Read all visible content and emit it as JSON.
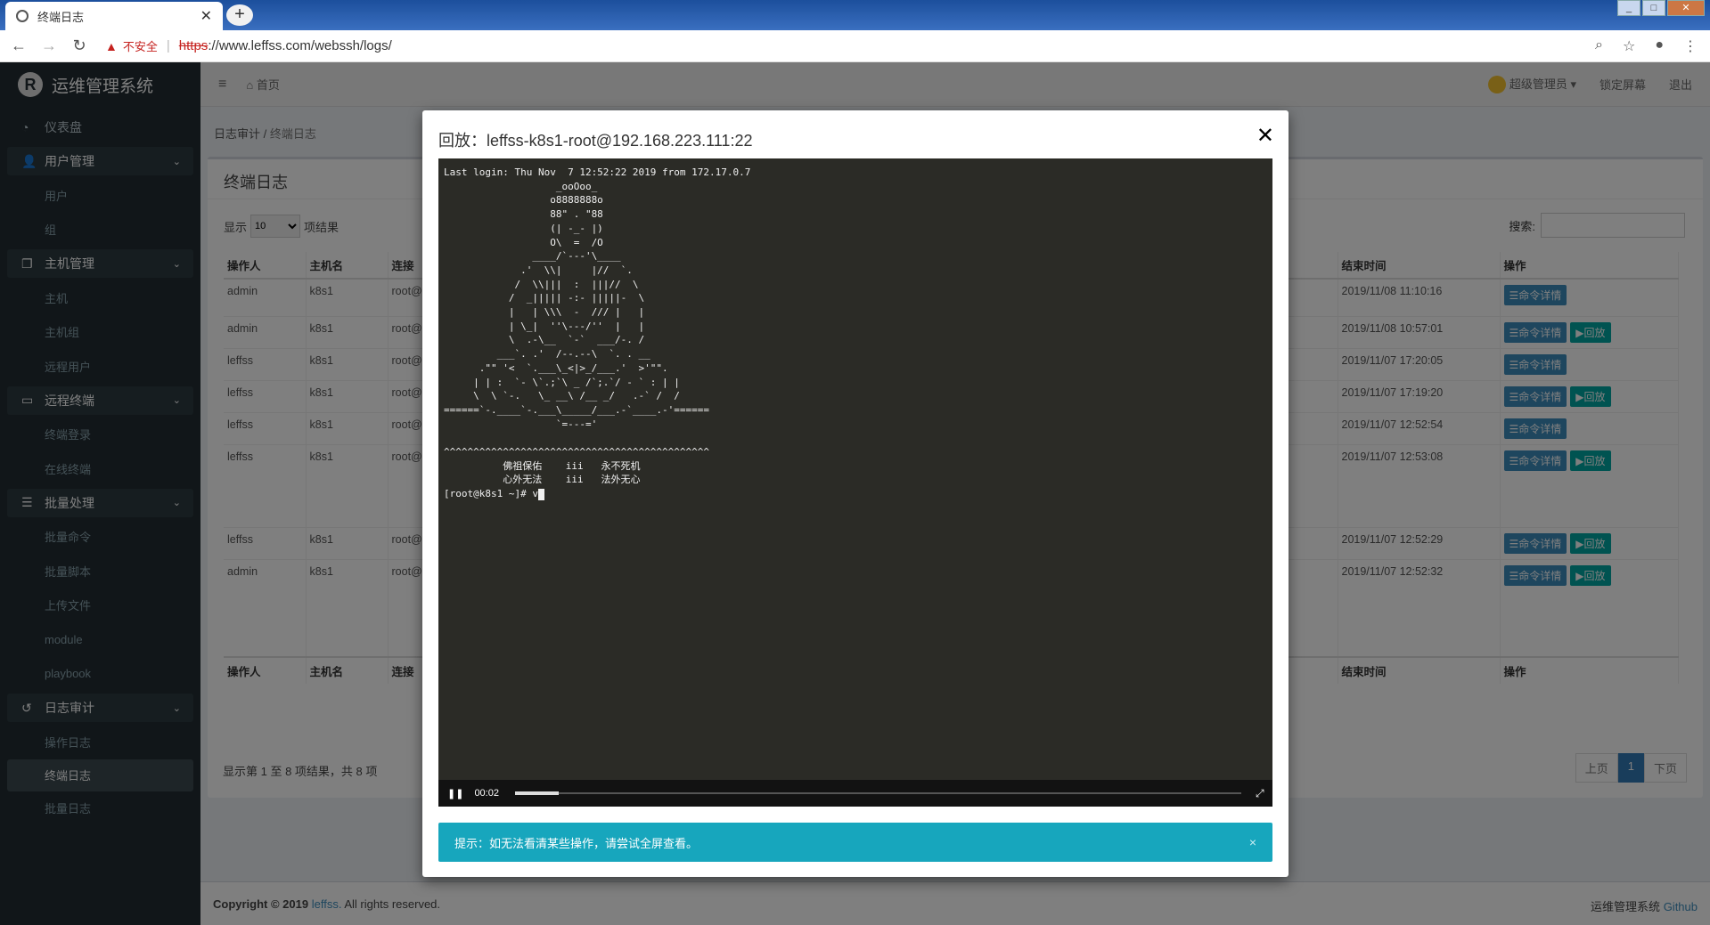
{
  "browser": {
    "tab_title": "终端日志",
    "insecure_label": "不安全",
    "url_scheme": "https",
    "url_rest": "://www.leffss.com/webssh/logs/"
  },
  "app": {
    "brand": "运维管理系统",
    "home": "首页",
    "user": "超级管理员",
    "lock": "锁定屏幕",
    "logout": "退出"
  },
  "sidebar": {
    "dashboard": "仪表盘",
    "groups": [
      {
        "label": "用户管理",
        "items": [
          "用户",
          "组"
        ]
      },
      {
        "label": "主机管理",
        "items": [
          "主机",
          "主机组",
          "远程用户"
        ]
      },
      {
        "label": "远程终端",
        "items": [
          "终端登录",
          "在线终端"
        ]
      },
      {
        "label": "批量处理",
        "items": [
          "批量命令",
          "批量脚本",
          "上传文件",
          "module",
          "playbook"
        ]
      },
      {
        "label": "日志审计",
        "items": [
          "操作日志",
          "终端日志",
          "批量日志"
        ]
      }
    ]
  },
  "breadcrumb": {
    "parent": "日志审计",
    "current": "终端日志"
  },
  "panel": {
    "title": "终端日志",
    "show_label": "显示",
    "page_size": "10",
    "result_label": "项结果",
    "search_label": "搜索:"
  },
  "table": {
    "headers": [
      "操作人",
      "主机名",
      "连接",
      "结束时间",
      "操作"
    ],
    "rows": [
      {
        "user": "admin",
        "host": "k8s1",
        "conn": "root@",
        "end": "2019/11/08 11:10:16",
        "replay": false
      },
      {
        "user": "admin",
        "host": "k8s1",
        "conn": "root@",
        "end": "2019/11/08 10:57:01",
        "replay": true
      },
      {
        "user": "leffss",
        "host": "k8s1",
        "conn": "root@",
        "end": "2019/11/07 17:20:05",
        "replay": false
      },
      {
        "user": "leffss",
        "host": "k8s1",
        "conn": "root@",
        "end": "2019/11/07 17:19:20",
        "replay": true
      },
      {
        "user": "leffss",
        "host": "k8s1",
        "conn": "root@",
        "end": "2019/11/07 12:52:54",
        "replay": false
      },
      {
        "user": "leffss",
        "host": "k8s1",
        "conn": "root@",
        "end": "2019/11/07 12:53:08",
        "replay": true
      },
      {
        "user": "leffss",
        "host": "k8s1",
        "conn": "root@",
        "end": "2019/11/07 12:52:29",
        "replay": true
      },
      {
        "user": "admin",
        "host": "k8s1",
        "conn": "root@",
        "end": "2019/11/07 12:52:32",
        "replay": true
      }
    ],
    "btn_detail": "命令详情",
    "btn_replay": "回放"
  },
  "pagination": {
    "info": "显示第 1 至 8 项结果，共 8 项",
    "prev": "上页",
    "page": "1",
    "next": "下页"
  },
  "footer": {
    "copyright": "Copyright © 2019",
    "owner": "leffss.",
    "rights": "All rights reserved.",
    "app": "运维管理系统",
    "github": "Github"
  },
  "modal": {
    "title": "回放：leffss-k8s1-root@192.168.223.111:22",
    "terminal_text": "Last login: Thu Nov  7 12:52:22 2019 from 172.17.0.7\n                   _ooOoo_\n                  o8888888o\n                  88\" . \"88\n                  (| -_- |)\n                  O\\  =  /O\n               ____/`---'\\____\n             .'  \\\\|     |//  `.\n            /  \\\\|||  :  |||//  \\\n           /  _||||| -:- |||||-  \\\n           |   | \\\\\\  -  /// |   |\n           | \\_|  ''\\---/''  |   |\n           \\  .-\\__  `-`  ___/-. /\n         ___`. .'  /--.--\\  `. . __\n      .\"\" '<  `.___\\_<|>_/___.'  >'\"\".\n     | | :  `- \\`.;`\\ _ /`;.`/ - ` : | |\n     \\  \\ `-.   \\_ __\\ /__ _/   .-` /  /\n======`-.____`-.___\\_____/___.-`____.-'======\n                   `=---='\n\n^^^^^^^^^^^^^^^^^^^^^^^^^^^^^^^^^^^^^^^^^^^^^\n          佛祖保佑    iii   永不死机\n          心外无法    iii   法外无心\n[root@k8s1 ~]# v",
    "elapsed": "00:02",
    "progress": 0.06,
    "alert": "提示：如无法看清某些操作，请尝试全屏查看。"
  }
}
